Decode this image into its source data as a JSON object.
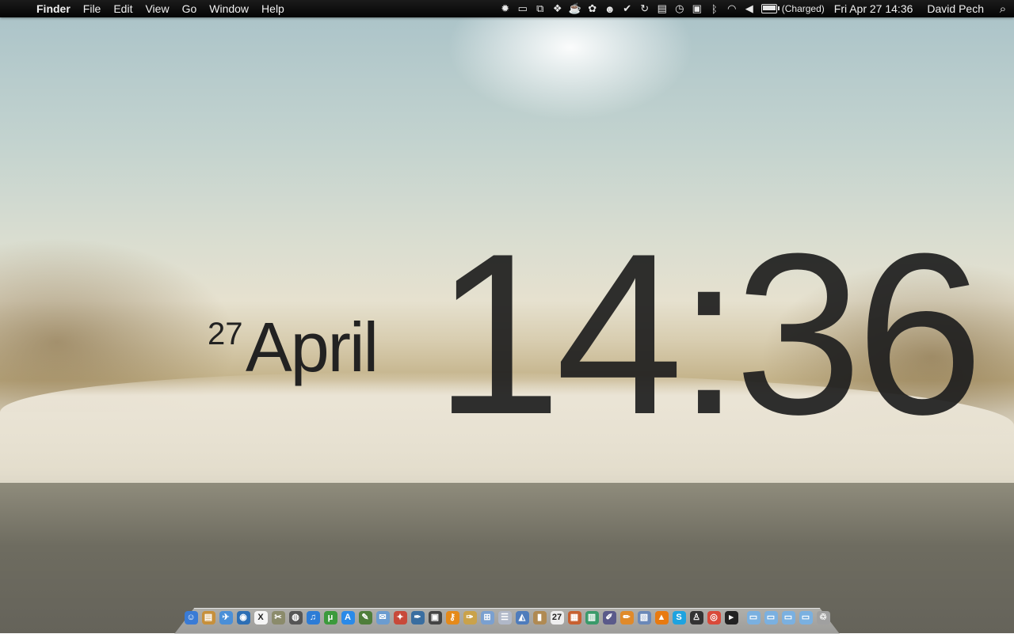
{
  "menubar": {
    "apple_icon": "",
    "app_name": "Finder",
    "menus": [
      "File",
      "Edit",
      "View",
      "Go",
      "Window",
      "Help"
    ],
    "tray_icons": [
      "gear-icon",
      "terminal-icon",
      "window-icon",
      "dropbox-icon",
      "cup-icon",
      "paw-icon",
      "robot-icon",
      "checkmark-icon",
      "sync-icon",
      "keyboard-icon",
      "time-machine-icon",
      "display-icon",
      "bluetooth-icon",
      "wifi-icon",
      "volume-icon"
    ],
    "battery": {
      "status": "(Charged)",
      "level": 1.0
    },
    "datetime": "Fri Apr 27  14:36",
    "user": "David Pech",
    "search_icon": "⌕"
  },
  "clock_widget": {
    "day": "27",
    "month": "April",
    "time": "14:36"
  },
  "dock": {
    "apps": [
      {
        "name": "finder",
        "color": "#3a7bd5",
        "glyph": "☺"
      },
      {
        "name": "archive",
        "color": "#c7903b",
        "glyph": "▤"
      },
      {
        "name": "mail",
        "color": "#4a8fd8",
        "glyph": "✈"
      },
      {
        "name": "globe",
        "color": "#2d6fb5",
        "glyph": "◉"
      },
      {
        "name": "x11",
        "color": "#f5f5f5",
        "glyph": "X"
      },
      {
        "name": "tools",
        "color": "#8b8b6b",
        "glyph": "✂"
      },
      {
        "name": "compass",
        "color": "#555",
        "glyph": "◍"
      },
      {
        "name": "itunes",
        "color": "#2d7cd6",
        "glyph": "♫"
      },
      {
        "name": "utorrent",
        "color": "#3c9a3c",
        "glyph": "μ"
      },
      {
        "name": "app-store",
        "color": "#2a8ae8",
        "glyph": "A"
      },
      {
        "name": "notes",
        "color": "#4f7e3a",
        "glyph": "✎"
      },
      {
        "name": "mail-alt",
        "color": "#6b9cd0",
        "glyph": "✉"
      },
      {
        "name": "colors",
        "color": "#c84a3a",
        "glyph": "✦"
      },
      {
        "name": "pen",
        "color": "#3a6ea0",
        "glyph": "✒"
      },
      {
        "name": "photos",
        "color": "#444",
        "glyph": "▣"
      },
      {
        "name": "ftp",
        "color": "#e58a1a",
        "glyph": "⚷"
      },
      {
        "name": "doc",
        "color": "#caa24a",
        "glyph": "✑"
      },
      {
        "name": "calc",
        "color": "#7aa0d0",
        "glyph": "⊞"
      },
      {
        "name": "list",
        "color": "#b0b8c8",
        "glyph": "☰"
      },
      {
        "name": "preview",
        "color": "#4e7cbc",
        "glyph": "◭"
      },
      {
        "name": "book",
        "color": "#b08a52",
        "glyph": "▮"
      },
      {
        "name": "calendar",
        "color": "#eeeeee",
        "glyph": "27"
      },
      {
        "name": "present",
        "color": "#c86030",
        "glyph": "▦"
      },
      {
        "name": "chart",
        "color": "#3a9a6a",
        "glyph": "▥"
      },
      {
        "name": "feather",
        "color": "#5a5a8a",
        "glyph": "✐"
      },
      {
        "name": "pages",
        "color": "#e08a2a",
        "glyph": "✏"
      },
      {
        "name": "keynote",
        "color": "#6a88b8",
        "glyph": "▧"
      },
      {
        "name": "vlc",
        "color": "#e87a10",
        "glyph": "▲"
      },
      {
        "name": "skype",
        "color": "#1ea3e0",
        "glyph": "S"
      },
      {
        "name": "figure",
        "color": "#333",
        "glyph": "♙"
      },
      {
        "name": "chrome",
        "color": "#d94a3a",
        "glyph": "◎"
      },
      {
        "name": "terminal",
        "color": "#222",
        "glyph": "▸"
      }
    ],
    "stacks": [
      {
        "name": "folder-1",
        "color": "#7ab0e0",
        "glyph": "▭"
      },
      {
        "name": "folder-2",
        "color": "#7ab0e0",
        "glyph": "▭"
      },
      {
        "name": "folder-3",
        "color": "#7ab0e0",
        "glyph": "▭"
      },
      {
        "name": "folder-4",
        "color": "#7ab0e0",
        "glyph": "▭"
      },
      {
        "name": "trash",
        "color": "#a0a0a0",
        "glyph": "♲"
      }
    ]
  }
}
